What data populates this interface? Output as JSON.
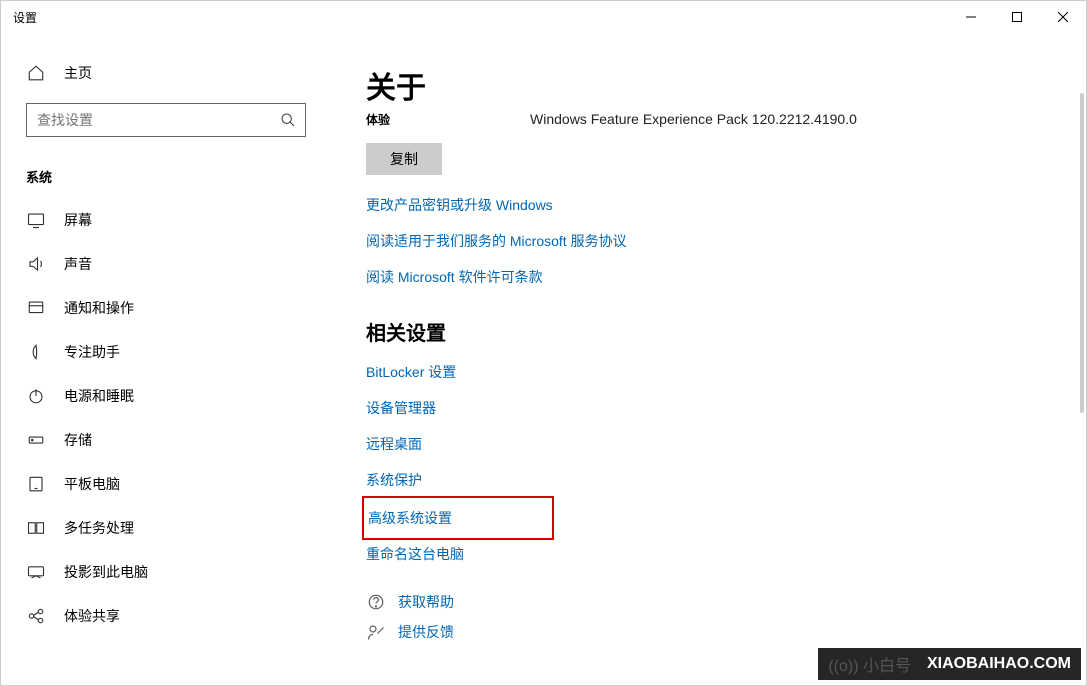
{
  "window": {
    "title": "设置"
  },
  "sidebar": {
    "home": "主页",
    "search_placeholder": "查找设置",
    "section": "系统",
    "items": [
      {
        "label": "屏幕"
      },
      {
        "label": "声音"
      },
      {
        "label": "通知和操作"
      },
      {
        "label": "专注助手"
      },
      {
        "label": "电源和睡眠"
      },
      {
        "label": "存储"
      },
      {
        "label": "平板电脑"
      },
      {
        "label": "多任务处理"
      },
      {
        "label": "投影到此电脑"
      },
      {
        "label": "体验共享"
      }
    ]
  },
  "main": {
    "title": "关于",
    "subhead": "体验",
    "feature_pack": "Windows Feature Experience Pack 120.2212.4190.0",
    "copy": "复制",
    "links": [
      "更改产品密钥或升级 Windows",
      "阅读适用于我们服务的 Microsoft 服务协议",
      "阅读 Microsoft 软件许可条款"
    ],
    "related_title": "相关设置",
    "related": [
      "BitLocker 设置",
      "设备管理器",
      "远程桌面",
      "系统保护",
      "高级系统设置",
      "重命名这台电脑"
    ],
    "help": "获取帮助",
    "feedback": "提供反馈"
  },
  "watermark": {
    "logo": "((o)) 小白号",
    "text": "XIAOBAIHAO.COM"
  }
}
